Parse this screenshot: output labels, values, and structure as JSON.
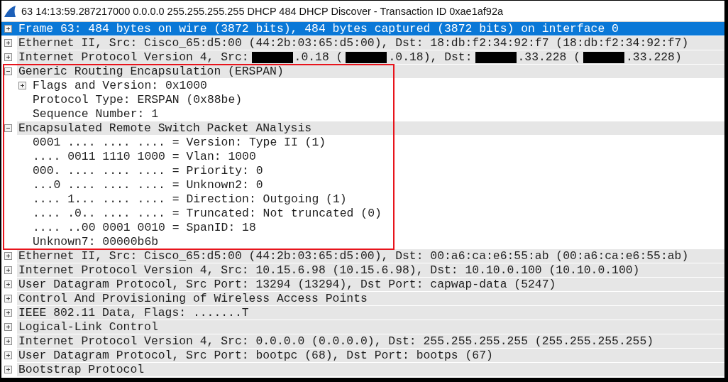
{
  "window": {
    "title": "63 14:13:59.287217000 0.0.0.0 255.255.255.255 DHCP 484 DHCP Discover - Transaction ID 0xae1af92a"
  },
  "tree": [
    {
      "kind": "branch",
      "expanded": false,
      "selected": true,
      "highlighted": false,
      "text": "Frame 63: 484 bytes on wire (3872 bits), 484 bytes captured (3872 bits) on interface 0"
    },
    {
      "kind": "branch",
      "expanded": false,
      "selected": false,
      "highlighted": false,
      "text": "Ethernet II, Src: Cisco_65:d5:00 (44:2b:03:65:d5:00), Dst: 18:db:f2:34:92:f7 (18:db:f2:34:92:f7)"
    },
    {
      "kind": "branch",
      "expanded": false,
      "selected": false,
      "highlighted": false,
      "segments": [
        {
          "kind": "text",
          "text": "Internet Protocol Version 4, Src: "
        },
        {
          "kind": "redacted"
        },
        {
          "kind": "text",
          "text": ".0.18 ("
        },
        {
          "kind": "redacted"
        },
        {
          "kind": "text",
          "text": ".0.18), Dst: "
        },
        {
          "kind": "redacted"
        },
        {
          "kind": "text",
          "text": ".33.228 ("
        },
        {
          "kind": "redacted"
        },
        {
          "kind": "text",
          "text": ".33.228)"
        }
      ]
    },
    {
      "kind": "branch",
      "expanded": true,
      "selected": false,
      "highlighted": true,
      "text": "Generic Routing Encapsulation (ERSPAN)",
      "children": [
        {
          "kind": "branch",
          "expanded": false,
          "selected": false,
          "text": "Flags and Version: 0x1000"
        },
        {
          "kind": "leaf",
          "selected": false,
          "text": "Protocol Type: ERSPAN (0x88be)"
        },
        {
          "kind": "leaf",
          "selected": false,
          "text": "Sequence Number: 1"
        }
      ]
    },
    {
      "kind": "branch",
      "expanded": true,
      "selected": false,
      "highlighted": true,
      "text": "Encapsulated Remote Switch Packet ANalysis",
      "children": [
        {
          "kind": "leaf",
          "selected": false,
          "text": "0001 .... .... .... = Version: Type II (1)"
        },
        {
          "kind": "leaf",
          "selected": false,
          "text": ".... 0011 1110 1000 = Vlan: 1000"
        },
        {
          "kind": "leaf",
          "selected": false,
          "text": "000. .... .... .... = Priority: 0"
        },
        {
          "kind": "leaf",
          "selected": false,
          "text": "...0 .... .... .... = Unknown2: 0"
        },
        {
          "kind": "leaf",
          "selected": false,
          "text": ".... 1... .... .... = Direction: Outgoing (1)"
        },
        {
          "kind": "leaf",
          "selected": false,
          "text": ".... .0.. .... .... = Truncated: Not truncated (0)"
        },
        {
          "kind": "leaf",
          "selected": false,
          "text": ".... ..00 0001 0010 = SpanID: 18"
        },
        {
          "kind": "leaf",
          "selected": false,
          "text": "Unknown7: 00000b6b"
        }
      ]
    },
    {
      "kind": "branch",
      "expanded": false,
      "selected": false,
      "highlighted": false,
      "text": "Ethernet II, Src: Cisco_65:d5:00 (44:2b:03:65:d5:00), Dst: 00:a6:ca:e6:55:ab (00:a6:ca:e6:55:ab)"
    },
    {
      "kind": "branch",
      "expanded": false,
      "selected": false,
      "highlighted": false,
      "text": "Internet Protocol Version 4, Src: 10.15.6.98 (10.15.6.98), Dst: 10.10.0.100 (10.10.0.100)"
    },
    {
      "kind": "branch",
      "expanded": false,
      "selected": false,
      "highlighted": false,
      "text": "User Datagram Protocol, Src Port: 13294 (13294), Dst Port: capwap-data (5247)"
    },
    {
      "kind": "branch",
      "expanded": false,
      "selected": false,
      "highlighted": false,
      "text": "Control And Provisioning of Wireless Access Points"
    },
    {
      "kind": "branch",
      "expanded": false,
      "selected": false,
      "highlighted": false,
      "text": "IEEE 802.11 Data, Flags: .......T"
    },
    {
      "kind": "branch",
      "expanded": false,
      "selected": false,
      "highlighted": false,
      "text": "Logical-Link Control"
    },
    {
      "kind": "branch",
      "expanded": false,
      "selected": false,
      "highlighted": false,
      "text": "Internet Protocol Version 4, Src: 0.0.0.0 (0.0.0.0), Dst: 255.255.255.255 (255.255.255.255)"
    },
    {
      "kind": "branch",
      "expanded": false,
      "selected": false,
      "highlighted": false,
      "text": "User Datagram Protocol, Src Port: bootpc (68), Dst Port: bootps (67)"
    },
    {
      "kind": "branch",
      "expanded": false,
      "selected": false,
      "highlighted": false,
      "text": "Bootstrap Protocol"
    }
  ]
}
